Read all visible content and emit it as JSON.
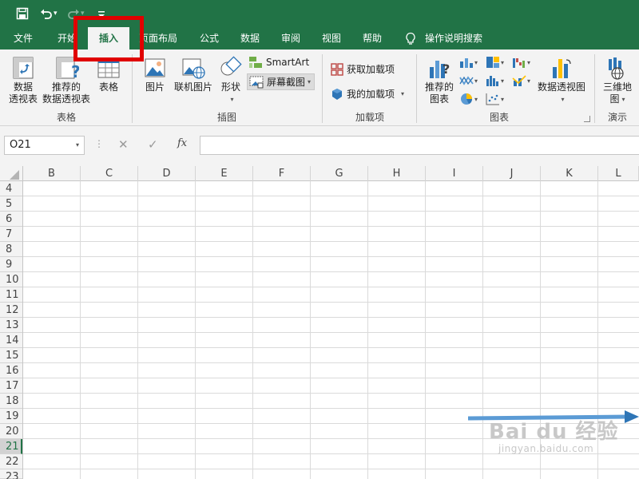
{
  "tabs": [
    {
      "label": "文件",
      "active": false
    },
    {
      "label": "开始",
      "active": false
    },
    {
      "label": "插入",
      "active": true
    },
    {
      "label": "页面布局",
      "active": false
    },
    {
      "label": "公式",
      "active": false
    },
    {
      "label": "数据",
      "active": false
    },
    {
      "label": "审阅",
      "active": false
    },
    {
      "label": "视图",
      "active": false
    },
    {
      "label": "帮助",
      "active": false
    }
  ],
  "tell_me": "操作说明搜索",
  "ribbon": {
    "tables": {
      "group_label": "表格",
      "pivot_line1": "数据",
      "pivot_line2": "透视表",
      "rec_pivot_line1": "推荐的",
      "rec_pivot_line2": "数据透视表",
      "table": "表格"
    },
    "illustrations": {
      "group_label": "插图",
      "pictures": "图片",
      "online_pictures": "联机图片",
      "shapes": "形状",
      "smartart": "SmartArt",
      "screenshot": "屏幕截图"
    },
    "addins": {
      "group_label": "加载项",
      "get_addins": "获取加载项",
      "my_addins": "我的加载项"
    },
    "charts": {
      "group_label": "图表",
      "rec_charts_line1": "推荐的",
      "rec_charts_line2": "图表",
      "pivot_chart": "数据透视图"
    },
    "tours": {
      "group_label": "演示",
      "map3d_line1": "三维地",
      "map3d_line2": "图"
    }
  },
  "formula_bar": {
    "name_box": "O21",
    "fx": "fx",
    "formula": ""
  },
  "grid": {
    "columns": [
      "B",
      "C",
      "D",
      "E",
      "F",
      "G",
      "H",
      "I",
      "J",
      "K",
      "L"
    ],
    "rows": [
      "4",
      "5",
      "6",
      "7",
      "8",
      "9",
      "10",
      "11",
      "12",
      "13",
      "14",
      "15",
      "16",
      "17",
      "18",
      "19",
      "20",
      "21",
      "22",
      "23"
    ],
    "selected_row": "21"
  },
  "colors": {
    "brand": "#217346",
    "highlight": "#e00000",
    "arrow": "#5b9bd5"
  },
  "watermark": {
    "main": "Bai du 经验",
    "sub": "jingyan.baidu.com"
  }
}
